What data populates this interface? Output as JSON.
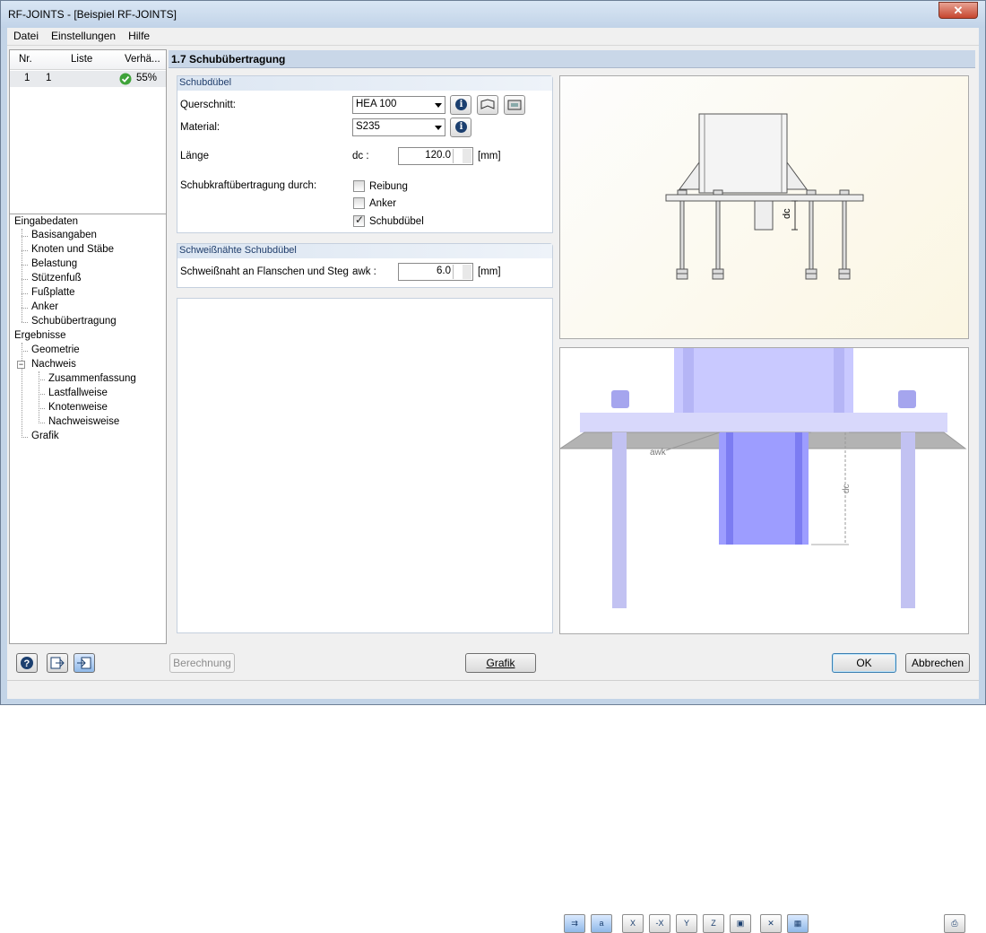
{
  "window": {
    "title": "RF-JOINTS - [Beispiel RF-JOINTS]",
    "close": "✕"
  },
  "menu": [
    "Datei",
    "Einstellungen",
    "Hilfe"
  ],
  "list": {
    "headers": {
      "nr": "Nr.",
      "liste": "Liste",
      "verh": "Verhä..."
    },
    "rows": [
      {
        "nr": "1",
        "liste": "1",
        "verh": "55%"
      }
    ]
  },
  "tree": {
    "eingabedaten": "Eingabedaten",
    "items_in": [
      "Basisangaben",
      "Knoten und Stäbe",
      "Belastung",
      "Stützenfuß",
      "Fußplatte",
      "Anker",
      "Schubübertragung"
    ],
    "ergebnisse": "Ergebnisse",
    "geometrie": "Geometrie",
    "nachweis": "Nachweis",
    "nachweis_sub": [
      "Zusammenfassung",
      "Lastfallweise",
      "Knotenweise",
      "Nachweisweise"
    ],
    "grafik": "Grafik",
    "expander": "−"
  },
  "main": {
    "title": "1.7 Schubübertragung",
    "g1": {
      "title": "Schubdübel",
      "querschnitt_label": "Querschnitt:",
      "querschnitt_value": "HEA 100",
      "material_label": "Material:",
      "material_value": "S235",
      "laenge_label": "Länge",
      "laenge_symbol": "dc :",
      "laenge_value": "120.0",
      "laenge_unit": "[mm]",
      "schub_label": "Schubkraftübertragung durch:",
      "opt_reibung": "Reibung",
      "opt_anker": "Anker",
      "opt_schubduebel": "Schubdübel"
    },
    "g2": {
      "title": "Schweißnähte Schubdübel",
      "label": "Schweißnaht an Flanschen und Steg",
      "symbol": "awk :",
      "value": "6.0",
      "unit": "[mm]"
    }
  },
  "drawing": {
    "dc": "dc",
    "awk": "awk"
  },
  "toolbar": [
    "⇉",
    "a",
    "X",
    "-X",
    "Y",
    "Z",
    "▣",
    "✕",
    "▦",
    "⎙"
  ],
  "buttons": {
    "berechnung": "Berechnung",
    "grafik": "Grafik",
    "ok": "OK",
    "abbrechen": "Abbrechen"
  },
  "icons": {
    "info": "i"
  }
}
